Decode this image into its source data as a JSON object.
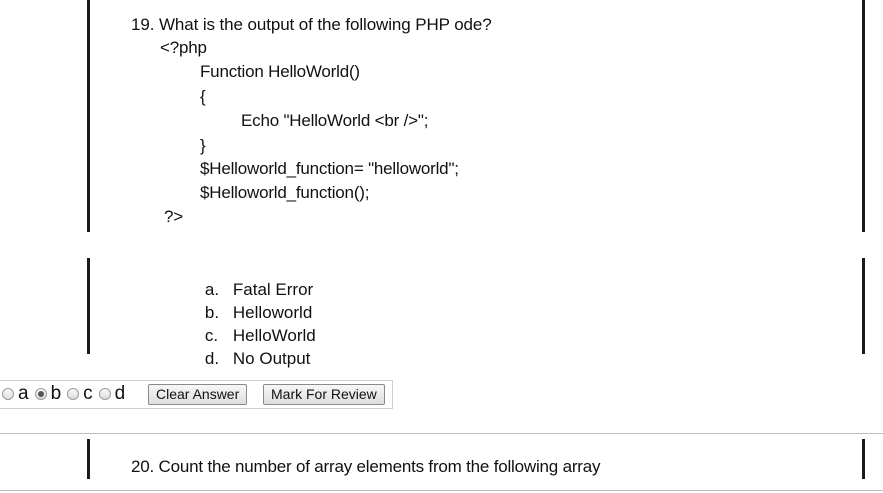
{
  "question19": {
    "title": "19. What is the output of the following PHP ode?",
    "code": [
      "<?php",
      "Function HelloWorld()",
      "{",
      "Echo \"HelloWorld <br />\";",
      "}",
      "$Helloworld_function= \"helloworld\";",
      "$Helloworld_function();",
      "?>"
    ],
    "options": [
      {
        "letter": "a.",
        "text": "Fatal Error"
      },
      {
        "letter": "b.",
        "text": "Helloworld"
      },
      {
        "letter": "c.",
        "text": "HelloWorld"
      },
      {
        "letter": "d.",
        "text": "No Output"
      }
    ]
  },
  "answer_bar": {
    "choices": [
      {
        "label": "a",
        "selected": false
      },
      {
        "label": "b",
        "selected": true
      },
      {
        "label": "c",
        "selected": false
      },
      {
        "label": "d",
        "selected": false
      }
    ],
    "clear_label": "Clear Answer",
    "review_label": "Mark For Review"
  },
  "question20": {
    "title": "20. Count the number of array elements from the following array"
  }
}
